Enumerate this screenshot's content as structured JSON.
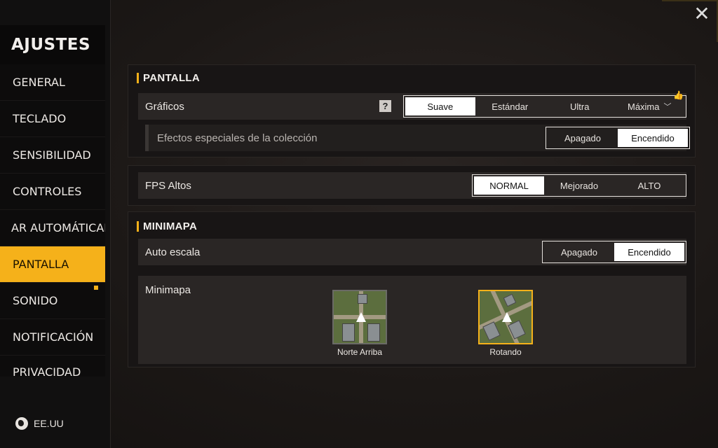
{
  "sidebar": {
    "title": "AJUSTES",
    "items": [
      {
        "label": "GENERAL",
        "active": false
      },
      {
        "label": "TECLADO",
        "active": false
      },
      {
        "label": "SENSIBILIDAD",
        "active": false
      },
      {
        "label": "CONTROLES",
        "active": false
      },
      {
        "label": "AR AUTOMÁTICAM",
        "active": false
      },
      {
        "label": "PANTALLA",
        "active": true
      },
      {
        "label": "SONIDO",
        "active": false
      },
      {
        "label": "NOTIFICACIÓN",
        "active": false
      },
      {
        "label": "PRIVACIDAD",
        "active": false
      }
    ],
    "region": "EE.UU"
  },
  "pantalla": {
    "title": "PANTALLA",
    "graficos": {
      "label": "Gráficos",
      "help": "?",
      "options": [
        "Suave",
        "Estándar",
        "Ultra",
        "Máxima"
      ],
      "selected": "Suave"
    },
    "efectos": {
      "label": "Efectos especiales de la colección",
      "options": [
        "Apagado",
        "Encendido"
      ],
      "selected": "Encendido"
    }
  },
  "fps": {
    "label": "FPS Altos",
    "options": [
      "NORMAL",
      "Mejorado",
      "ALTO"
    ],
    "selected": "NORMAL"
  },
  "minimapa": {
    "title": "MINIMAPA",
    "auto_escala": {
      "label": "Auto escala",
      "options": [
        "Apagado",
        "Encendido"
      ],
      "selected": "Encendido"
    },
    "mode": {
      "label": "Minimapa",
      "options": [
        "Norte Arriba",
        "Rotando"
      ],
      "selected": "Rotando"
    }
  },
  "colors": {
    "accent": "#f5b11a",
    "background": "#1c1816",
    "row": "#2a2625"
  }
}
